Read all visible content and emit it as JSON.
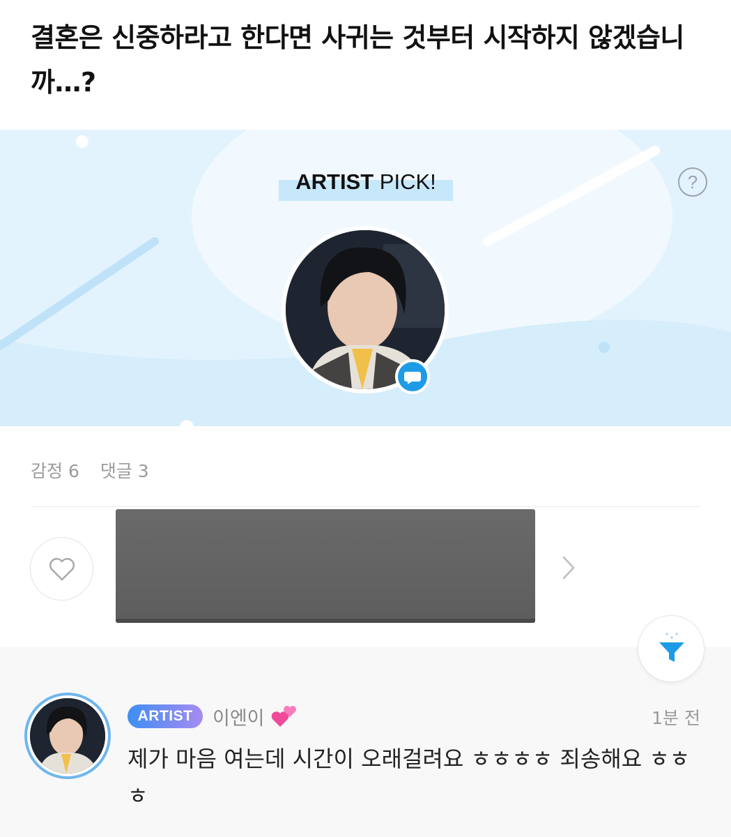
{
  "post": {
    "title": "결혼은 신중하라고 한다면 사귀는 것부터 시작하지 않겠습니까…?"
  },
  "artist_pick": {
    "title_bold": "ARTIST",
    "title_rest": " PICK!",
    "help_icon": "?"
  },
  "stats": {
    "reactions_label": "감정 6",
    "comments_label": "댓글 3"
  },
  "comment": {
    "badge": "ARTIST",
    "author": "이엔이",
    "time": "1분 전",
    "text": "제가 마음 여는데 시간이 오래걸려요 ㅎㅎㅎㅎ 죄송해요 ㅎㅎㅎ",
    "emoji": "two-hearts"
  },
  "colors": {
    "banner_bg": "#e3f3fd",
    "accent_blue": "#1e9be7",
    "badge_gradient_start": "#3e8ef3",
    "badge_gradient_end": "#a78bf2"
  },
  "icons": {
    "help": "question-circle-icon",
    "chat": "chat-bubble-icon",
    "like": "heart-outline-icon",
    "next": "chevron-right-icon",
    "filter": "funnel-icon"
  }
}
